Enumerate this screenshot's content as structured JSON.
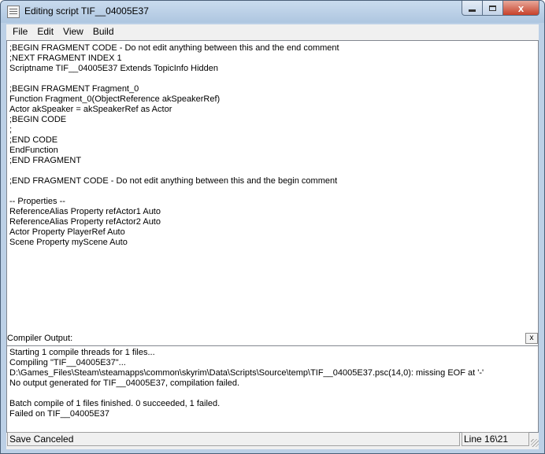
{
  "window": {
    "title": "Editing script TIF__04005E37",
    "close_glyph": "x"
  },
  "menu": {
    "file": "File",
    "edit": "Edit",
    "view": "View",
    "build": "Build"
  },
  "editor": {
    "lines": [
      ";BEGIN FRAGMENT CODE - Do not edit anything between this and the end comment",
      ";NEXT FRAGMENT INDEX 1",
      "Scriptname TIF__04005E37 Extends TopicInfo Hidden",
      "",
      ";BEGIN FRAGMENT Fragment_0",
      "Function Fragment_0(ObjectReference akSpeakerRef)",
      "Actor akSpeaker = akSpeakerRef as Actor",
      ";BEGIN CODE",
      ";",
      ";END CODE",
      "EndFunction",
      ";END FRAGMENT",
      "",
      ";END FRAGMENT CODE - Do not edit anything between this and the begin comment",
      "",
      "-- Properties --",
      "ReferenceAlias Property refActor1 Auto",
      "ReferenceAlias Property refActor2 Auto",
      "Actor Property PlayerRef Auto",
      "Scene Property myScene Auto"
    ]
  },
  "compiler": {
    "label": "Compiler Output:",
    "close_label": "x",
    "lines": [
      "Starting 1 compile threads for 1 files...",
      "Compiling \"TIF__04005E37\"...",
      "D:\\Games_Files\\Steam\\steamapps\\common\\skyrim\\Data\\Scripts\\Source\\temp\\TIF__04005E37.psc(14,0): missing EOF at '-'",
      "No output generated for TIF__04005E37, compilation failed.",
      "",
      "Batch compile of 1 files finished. 0 succeeded, 1 failed.",
      "Failed on TIF__04005E37"
    ]
  },
  "status": {
    "message": "Save Canceled",
    "position": "Line 16\\21"
  }
}
